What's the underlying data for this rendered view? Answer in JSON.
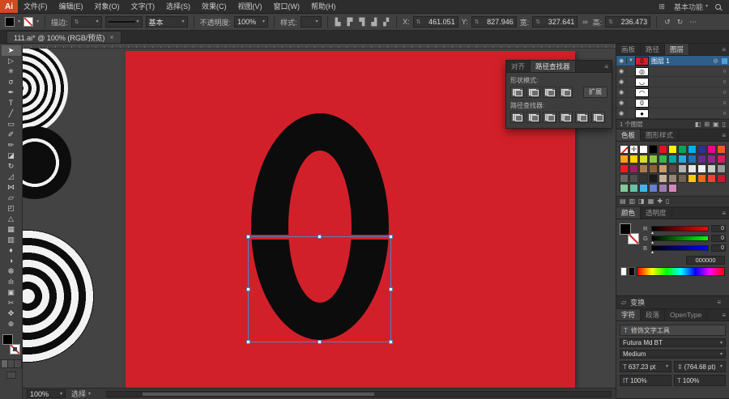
{
  "menubar": {
    "logo": "Ai",
    "items": [
      {
        "name": "file",
        "label": "文件(F)"
      },
      {
        "name": "edit",
        "label": "编辑(E)"
      },
      {
        "name": "object",
        "label": "对象(O)"
      },
      {
        "name": "type",
        "label": "文字(T)"
      },
      {
        "name": "select",
        "label": "选择(S)"
      },
      {
        "name": "effect",
        "label": "效果(C)"
      },
      {
        "name": "view",
        "label": "视图(V)"
      },
      {
        "name": "window",
        "label": "窗口(W)"
      },
      {
        "name": "help",
        "label": "帮助(H)"
      }
    ],
    "workspace": "基本功能"
  },
  "controlbar": {
    "stroke_label": "描边:",
    "stroke_width": "",
    "brush": "基本",
    "opacity_label": "不透明度:",
    "opacity_value": "100%",
    "style_label": "样式:",
    "fields": [
      {
        "label": "X:",
        "value": "461.051"
      },
      {
        "label": "Y:",
        "value": "827.946"
      },
      {
        "label": "宽:",
        "value": "327.641"
      },
      {
        "label": "高:",
        "value": "236.473"
      }
    ]
  },
  "tabbar": {
    "title": "111.ai* @ 100% (RGB/预览)",
    "close": "×"
  },
  "toolbar": {
    "fill_color": "#000000",
    "tools": [
      {
        "name": "selection",
        "glyph": "➤",
        "active": true
      },
      {
        "name": "direct-selection",
        "glyph": "▷"
      },
      {
        "name": "magic-wand",
        "glyph": "✳"
      },
      {
        "name": "lasso",
        "glyph": "σ"
      },
      {
        "name": "pen",
        "glyph": "✒"
      },
      {
        "name": "type",
        "glyph": "T"
      },
      {
        "name": "line-segment",
        "glyph": "╱"
      },
      {
        "name": "rectangle",
        "glyph": "▭"
      },
      {
        "name": "paintbrush",
        "glyph": "✐"
      },
      {
        "name": "pencil",
        "glyph": "✏"
      },
      {
        "name": "eraser",
        "glyph": "◪"
      },
      {
        "name": "rotate",
        "glyph": "↻"
      },
      {
        "name": "scale",
        "glyph": "◿"
      },
      {
        "name": "width",
        "glyph": "⋈"
      },
      {
        "name": "free-transform",
        "glyph": "▱"
      },
      {
        "name": "shape-builder",
        "glyph": "◰"
      },
      {
        "name": "perspective-grid",
        "glyph": "△"
      },
      {
        "name": "mesh",
        "glyph": "▦"
      },
      {
        "name": "gradient",
        "glyph": "▥"
      },
      {
        "name": "eyedropper",
        "glyph": "♦"
      },
      {
        "name": "blend",
        "glyph": "◑"
      },
      {
        "name": "symbol-sprayer",
        "glyph": "❆"
      },
      {
        "name": "column-graph",
        "glyph": "ılı"
      },
      {
        "name": "artboard",
        "glyph": "▣"
      },
      {
        "name": "slice",
        "glyph": "✂"
      },
      {
        "name": "hand",
        "glyph": "✥"
      },
      {
        "name": "zoom",
        "glyph": "⊕"
      }
    ]
  },
  "canvas": {
    "artboard_color": "#d2202a",
    "glyph_color": "#0c0c0c",
    "selection_color": "#4a86c8",
    "pasteboard_color": "#434343"
  },
  "pathfinder": {
    "tabs": [
      {
        "label": "对齐"
      },
      {
        "label": "路径查找器",
        "active": true
      }
    ],
    "shape_modes_label": "形状模式:",
    "expand_label": "扩展",
    "pathfinder_label": "路径查找器:",
    "shape_modes": [
      {
        "name": "unite"
      },
      {
        "name": "minus-front"
      },
      {
        "name": "intersect"
      },
      {
        "name": "exclude"
      }
    ],
    "ops": [
      {
        "name": "divide"
      },
      {
        "name": "trim"
      },
      {
        "name": "merge"
      },
      {
        "name": "crop"
      },
      {
        "name": "outline"
      },
      {
        "name": "minus-back"
      }
    ]
  },
  "layers_panel": {
    "tabs": [
      {
        "label": "画板"
      },
      {
        "label": "路径"
      },
      {
        "label": "图层",
        "active": true
      }
    ],
    "rows": [
      {
        "name": "图层 1",
        "expander": "▼",
        "thumb": "red-zero",
        "glyph": "0",
        "selected": true,
        "eye": "◉"
      },
      {
        "name": "",
        "thumb": "white",
        "glyph": "◎",
        "eye": "◉"
      },
      {
        "name": "",
        "thumb": "white",
        "glyph": "◡",
        "eye": "◉"
      },
      {
        "name": "",
        "thumb": "white",
        "glyph": "◠",
        "eye": "◉"
      },
      {
        "name": "",
        "thumb": "white",
        "glyph": "0",
        "eye": "◉"
      },
      {
        "name": "",
        "thumb": "white",
        "glyph": "●",
        "eye": "◉"
      }
    ],
    "footer": "1 个图层",
    "footer_icons": [
      {
        "name": "make-clipping-mask-icon",
        "glyph": "◧"
      },
      {
        "name": "new-sublayer-icon",
        "glyph": "⊞"
      },
      {
        "name": "new-layer-icon",
        "glyph": "▣"
      },
      {
        "name": "delete-layer-icon",
        "glyph": "▯"
      }
    ]
  },
  "swatches_panel": {
    "tabs": [
      {
        "label": "色板",
        "active": true
      },
      {
        "label": "图形样式"
      }
    ],
    "colors": [
      "none",
      "reg",
      "#ffffff",
      "#000000",
      "#e81123",
      "#fff100",
      "#00a651",
      "#00adef",
      "#2e3192",
      "#ec008c",
      "#f05a28",
      "#faa21b",
      "#ffd400",
      "#d7df23",
      "#8dc63f",
      "#39b54a",
      "#00a99d",
      "#27aae1",
      "#1c75bc",
      "#662d91",
      "#92278f",
      "#da1c5c",
      "#ed1c24",
      "#9e1f63",
      "#a97c50",
      "#8c6239",
      "#c69c6d",
      "#594a42",
      "#b3b3b3",
      "#e6e6e6",
      "#f2f2f2",
      "#cccccc",
      "#999999",
      "#666666",
      "#4d4d4d",
      "#333333",
      "#1a1a1a",
      "#c7b299",
      "#998675",
      "#736357",
      "#ffcb05",
      "#f26522",
      "#ef4136",
      "#be1e2d",
      "#88c999",
      "#66c2a4",
      "#41b6e6",
      "#6a7fd2",
      "#9d7bb0",
      "#d288b9"
    ],
    "footer_icons": [
      {
        "name": "swatch-libraries-icon",
        "glyph": "▤"
      },
      {
        "name": "swatch-kinds-icon",
        "glyph": "▥"
      },
      {
        "name": "swatch-options-icon",
        "glyph": "◨"
      },
      {
        "name": "new-color-group-icon",
        "glyph": "▦"
      },
      {
        "name": "new-swatch-icon",
        "glyph": "✚"
      },
      {
        "name": "delete-swatch-icon",
        "glyph": "▯"
      }
    ]
  },
  "color_panel": {
    "tabs": [
      {
        "label": "颜色",
        "active": true
      },
      {
        "label": "透明度"
      }
    ],
    "sliders": [
      {
        "label": "R",
        "value": "0",
        "from": "#000000",
        "to": "#ff0000"
      },
      {
        "label": "G",
        "value": "0",
        "from": "#000000",
        "to": "#00ff00"
      },
      {
        "label": "B",
        "value": "0",
        "from": "#000000",
        "to": "#0000ff"
      }
    ],
    "hex": "000000",
    "spectrum_chips": [
      "#ffffff",
      "#000000"
    ]
  },
  "transform_panel": {
    "title": "变换"
  },
  "character_panel": {
    "tabs": [
      {
        "label": "字符",
        "active": true
      },
      {
        "label": "段落"
      },
      {
        "label": "OpenType"
      }
    ],
    "touch_tool": "修饰文字工具",
    "font": "Futura Md BT",
    "style": "Medium",
    "size": "637.23 pt",
    "leading": "(764.68 pt)",
    "v_scale": "100%",
    "h_scale": "100%"
  },
  "statusbar": {
    "zoom": "100%",
    "mode": "选择"
  }
}
